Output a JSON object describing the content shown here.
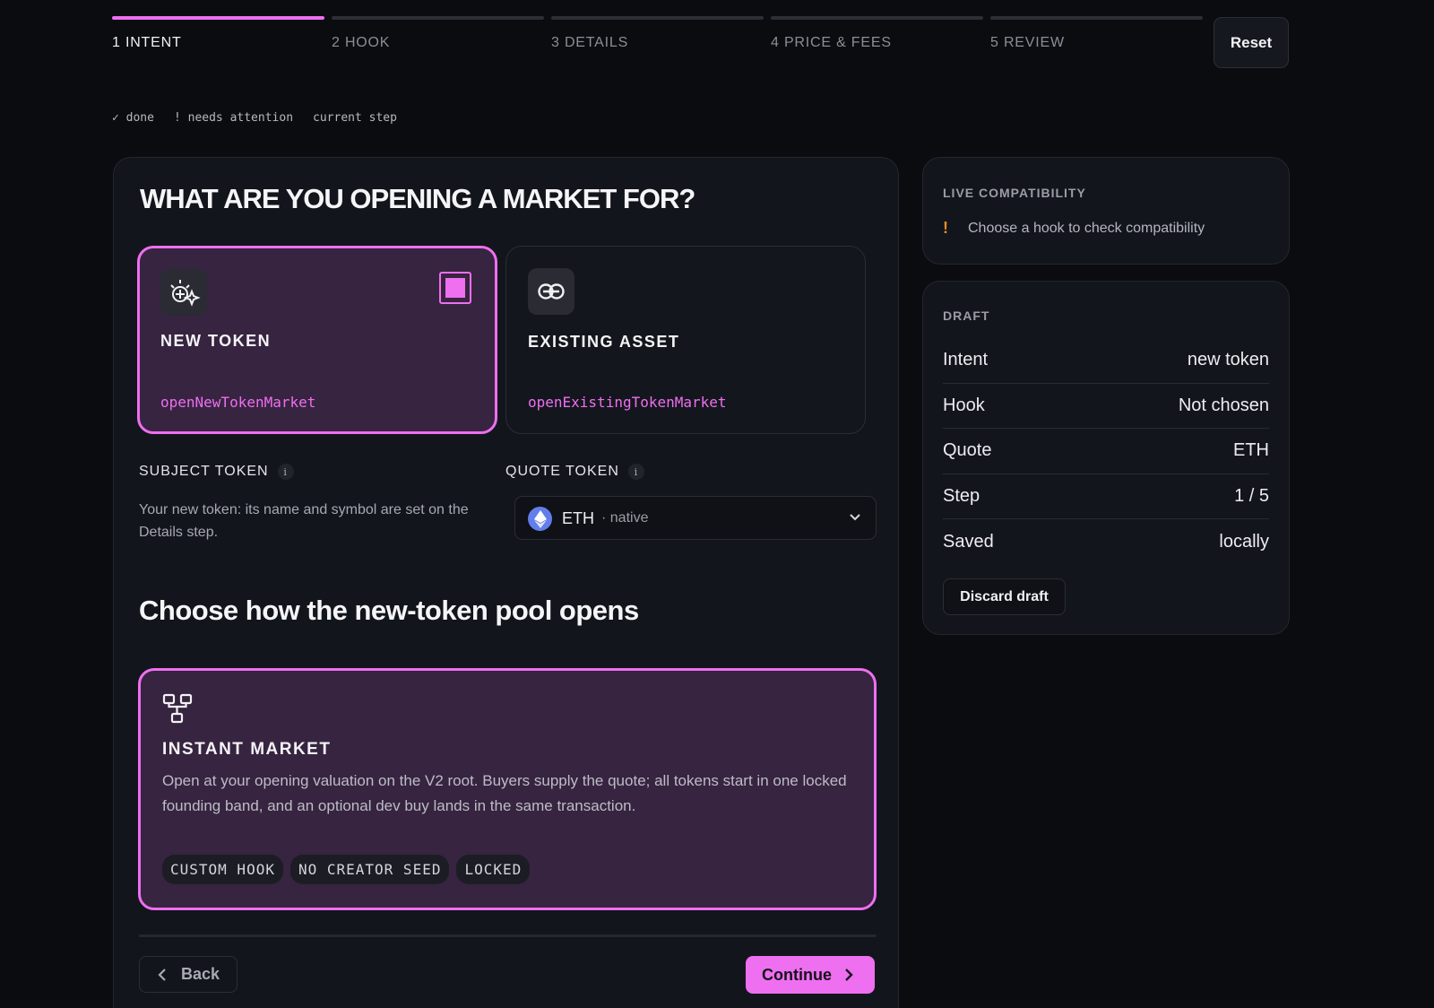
{
  "stepper": {
    "steps": [
      {
        "label": "1 INTENT"
      },
      {
        "label": "2 HOOK"
      },
      {
        "label": "3 DETAILS"
      },
      {
        "label": "4 PRICE & FEES"
      },
      {
        "label": "5 REVIEW"
      }
    ],
    "active_step": 1,
    "reset_label": "Reset"
  },
  "legend": {
    "done": "✓ done",
    "attention": "! needs attention",
    "current": "current step"
  },
  "main": {
    "title": "WHAT ARE YOU OPENING A MARKET FOR?",
    "intents": [
      {
        "title": "NEW TOKEN",
        "fn": "openNewTokenMarket",
        "icon": "sparkle-plus-icon",
        "selected": true
      },
      {
        "title": "EXISTING ASSET",
        "fn": "openExistingTokenMarket",
        "icon": "link-icon",
        "selected": false
      }
    ],
    "subject": {
      "label": "SUBJECT TOKEN",
      "info": "i",
      "desc": "Your new token: its name and symbol are set on the Details step."
    },
    "quote": {
      "label": "QUOTE TOKEN",
      "info": "i",
      "symbol": "ETH",
      "sub": "· native",
      "icon": "eth-icon"
    },
    "section_title": "Choose how the new-token pool opens",
    "hook": {
      "title": "INSTANT MARKET",
      "icon": "nodes-icon",
      "desc": "Open at your opening valuation on the V2 root. Buyers supply the quote; all tokens start in one locked founding band, and an optional dev buy lands in the same transaction.",
      "tags": [
        "CUSTOM HOOK",
        "NO CREATOR SEED",
        "LOCKED"
      ]
    },
    "back_label": "Back",
    "continue_label": "Continue"
  },
  "compat": {
    "heading": "LIVE COMPATIBILITY",
    "warn": "!",
    "message": "Choose a hook to check compatibility"
  },
  "draft": {
    "heading": "DRAFT",
    "rows": [
      {
        "key": "Intent",
        "value": "new token"
      },
      {
        "key": "Hook",
        "value": "Not chosen"
      },
      {
        "key": "Quote",
        "value": "ETH"
      },
      {
        "key": "Step",
        "value": "1 / 5"
      },
      {
        "key": "Saved",
        "value": "locally"
      }
    ],
    "discard_label": "Discard draft"
  },
  "colors": {
    "accent": "#ee6ff0",
    "background": "#0b0c10",
    "panel": "#13151c",
    "selected_card": "#372440",
    "warning": "#e98b2a"
  }
}
